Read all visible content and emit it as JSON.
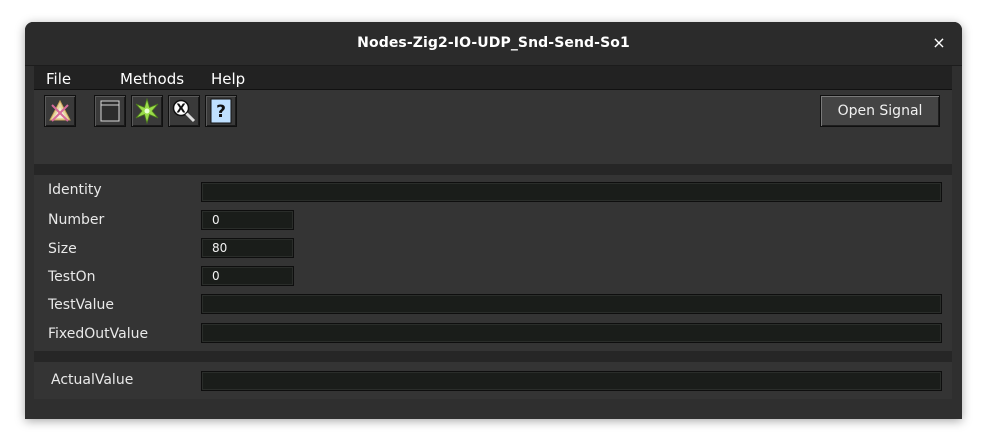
{
  "window": {
    "title": "Nodes-Zig2-IO-UDP_Snd-Send-So1",
    "close_glyph": "×"
  },
  "menu": {
    "file": "File",
    "methods": "Methods",
    "help": "Help"
  },
  "toolbar": {
    "icons": [
      "navigator-icon",
      "open-graph-icon",
      "crossref-icon",
      "object-search-icon",
      "help-icon"
    ],
    "open_signal_label": "Open Signal"
  },
  "fields": {
    "identity": {
      "label": "Identity",
      "value": ""
    },
    "number": {
      "label": "Number",
      "value": "0"
    },
    "size": {
      "label": "Size",
      "value": "80"
    },
    "teston": {
      "label": "TestOn",
      "value": "0"
    },
    "testvalue": {
      "label": "TestValue",
      "value": ""
    },
    "fixedoutvalue": {
      "label": "FixedOutValue",
      "value": ""
    },
    "actualvalue": {
      "label": "ActualValue",
      "value": ""
    }
  },
  "colors": {
    "window_bg": "#2f2f2f",
    "field_bg": "#1a1d1a",
    "accent_green": "#9bdc4a",
    "help_blue": "#bfe0ff"
  }
}
